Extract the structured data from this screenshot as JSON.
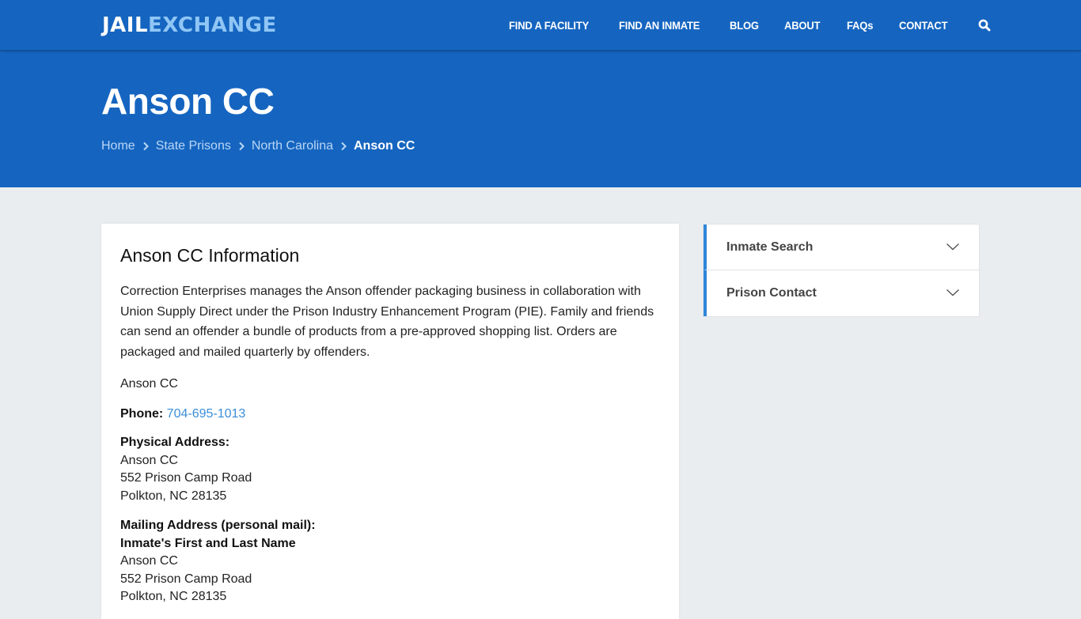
{
  "header": {
    "logo": {
      "part1": "JAIL",
      "part2": "EXCHANGE"
    },
    "nav": [
      {
        "label": "FIND A FACILITY"
      },
      {
        "label": "FIND AN INMATE"
      },
      {
        "label": "BLOG"
      },
      {
        "label": "ABOUT"
      },
      {
        "label": "FAQs"
      },
      {
        "label": "CONTACT"
      }
    ],
    "search_icon": "search-icon"
  },
  "hero": {
    "title": "Anson CC",
    "breadcrumb": [
      {
        "label": "Home"
      },
      {
        "label": "State Prisons"
      },
      {
        "label": "North Carolina"
      },
      {
        "label": "Anson CC"
      }
    ]
  },
  "main": {
    "heading": "Anson CC Information",
    "description": "Correction Enterprises manages the Anson offender packaging business in collaboration with Union Supply Direct under the Prison Industry Enhancement Program (PIE). Family and friends can send an offender a bundle of products from a pre-approved shopping list. Orders are packaged and mailed quarterly by offenders.",
    "facility_name": "Anson CC",
    "phone": {
      "label": "Phone:",
      "value": "704-695-1013"
    },
    "physical_address": {
      "label": "Physical Address:",
      "lines": [
        "Anson CC",
        "552 Prison Camp Road",
        "Polkton, NC 28135"
      ]
    },
    "mailing_address": {
      "label": "Mailing Address (personal mail):",
      "recipient": "Inmate's First and Last Name",
      "lines": [
        "Anson CC",
        "552 Prison Camp Road",
        "Polkton, NC 28135"
      ]
    }
  },
  "sidebar": {
    "accordion": [
      {
        "label": "Inmate Search"
      },
      {
        "label": "Prison Contact"
      }
    ]
  },
  "colors": {
    "brand_blue": "#1565c0",
    "logo_accent": "#90c6f5",
    "link": "#3b8ed8",
    "accordion_accent": "#2f86d9",
    "page_bg": "#e9edf0"
  }
}
